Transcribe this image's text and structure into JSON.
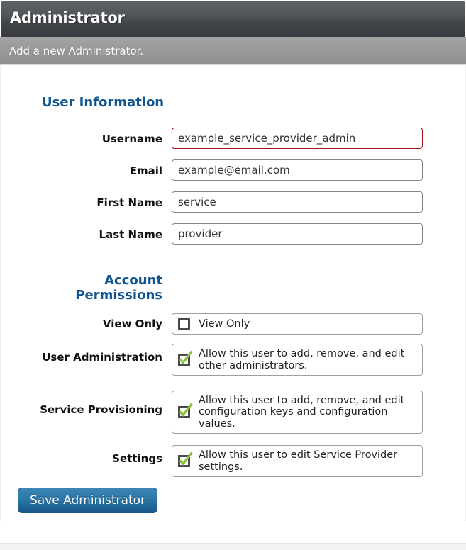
{
  "header": {
    "title": "Administrator",
    "subtitle": "Add a new Administrator."
  },
  "sections": {
    "user_information": {
      "title": "User Information",
      "fields": [
        {
          "label": "Username",
          "value": "example_service_provider_admin",
          "state": "invalid"
        },
        {
          "label": "Email",
          "value": "example@email.com",
          "state": "normal"
        },
        {
          "label": "First Name",
          "value": "service",
          "state": "normal"
        },
        {
          "label": "Last Name",
          "value": "provider",
          "state": "normal"
        }
      ]
    },
    "account_permissions": {
      "title_line1": "Account",
      "title_line2": "Permissions",
      "permissions": [
        {
          "label": "View Only",
          "description": "View Only",
          "checked": false,
          "icon": "checkbox-unchecked-icon"
        },
        {
          "label": "User Administration",
          "description": "Allow this user to add, remove, and edit other administrators.",
          "checked": true,
          "icon": "checkbox-checked-icon"
        },
        {
          "label": "Service Provisioning",
          "description": "Allow this user to add, remove, and edit configuration keys and configuration values.",
          "checked": true,
          "icon": "checkbox-checked-icon"
        },
        {
          "label": "Settings",
          "description": "Allow this user to edit Service Provider settings.",
          "checked": true,
          "icon": "checkbox-checked-icon"
        }
      ]
    }
  },
  "actions": {
    "save_label": "Save Administrator"
  },
  "colors": {
    "heading_blue": "#10558d",
    "button_blue": "#2b77a8",
    "invalid_border": "#a01515",
    "check_green": "#8cbf3f",
    "titlebar_dark": "#454a4f",
    "subheader_gray": "#999999"
  }
}
